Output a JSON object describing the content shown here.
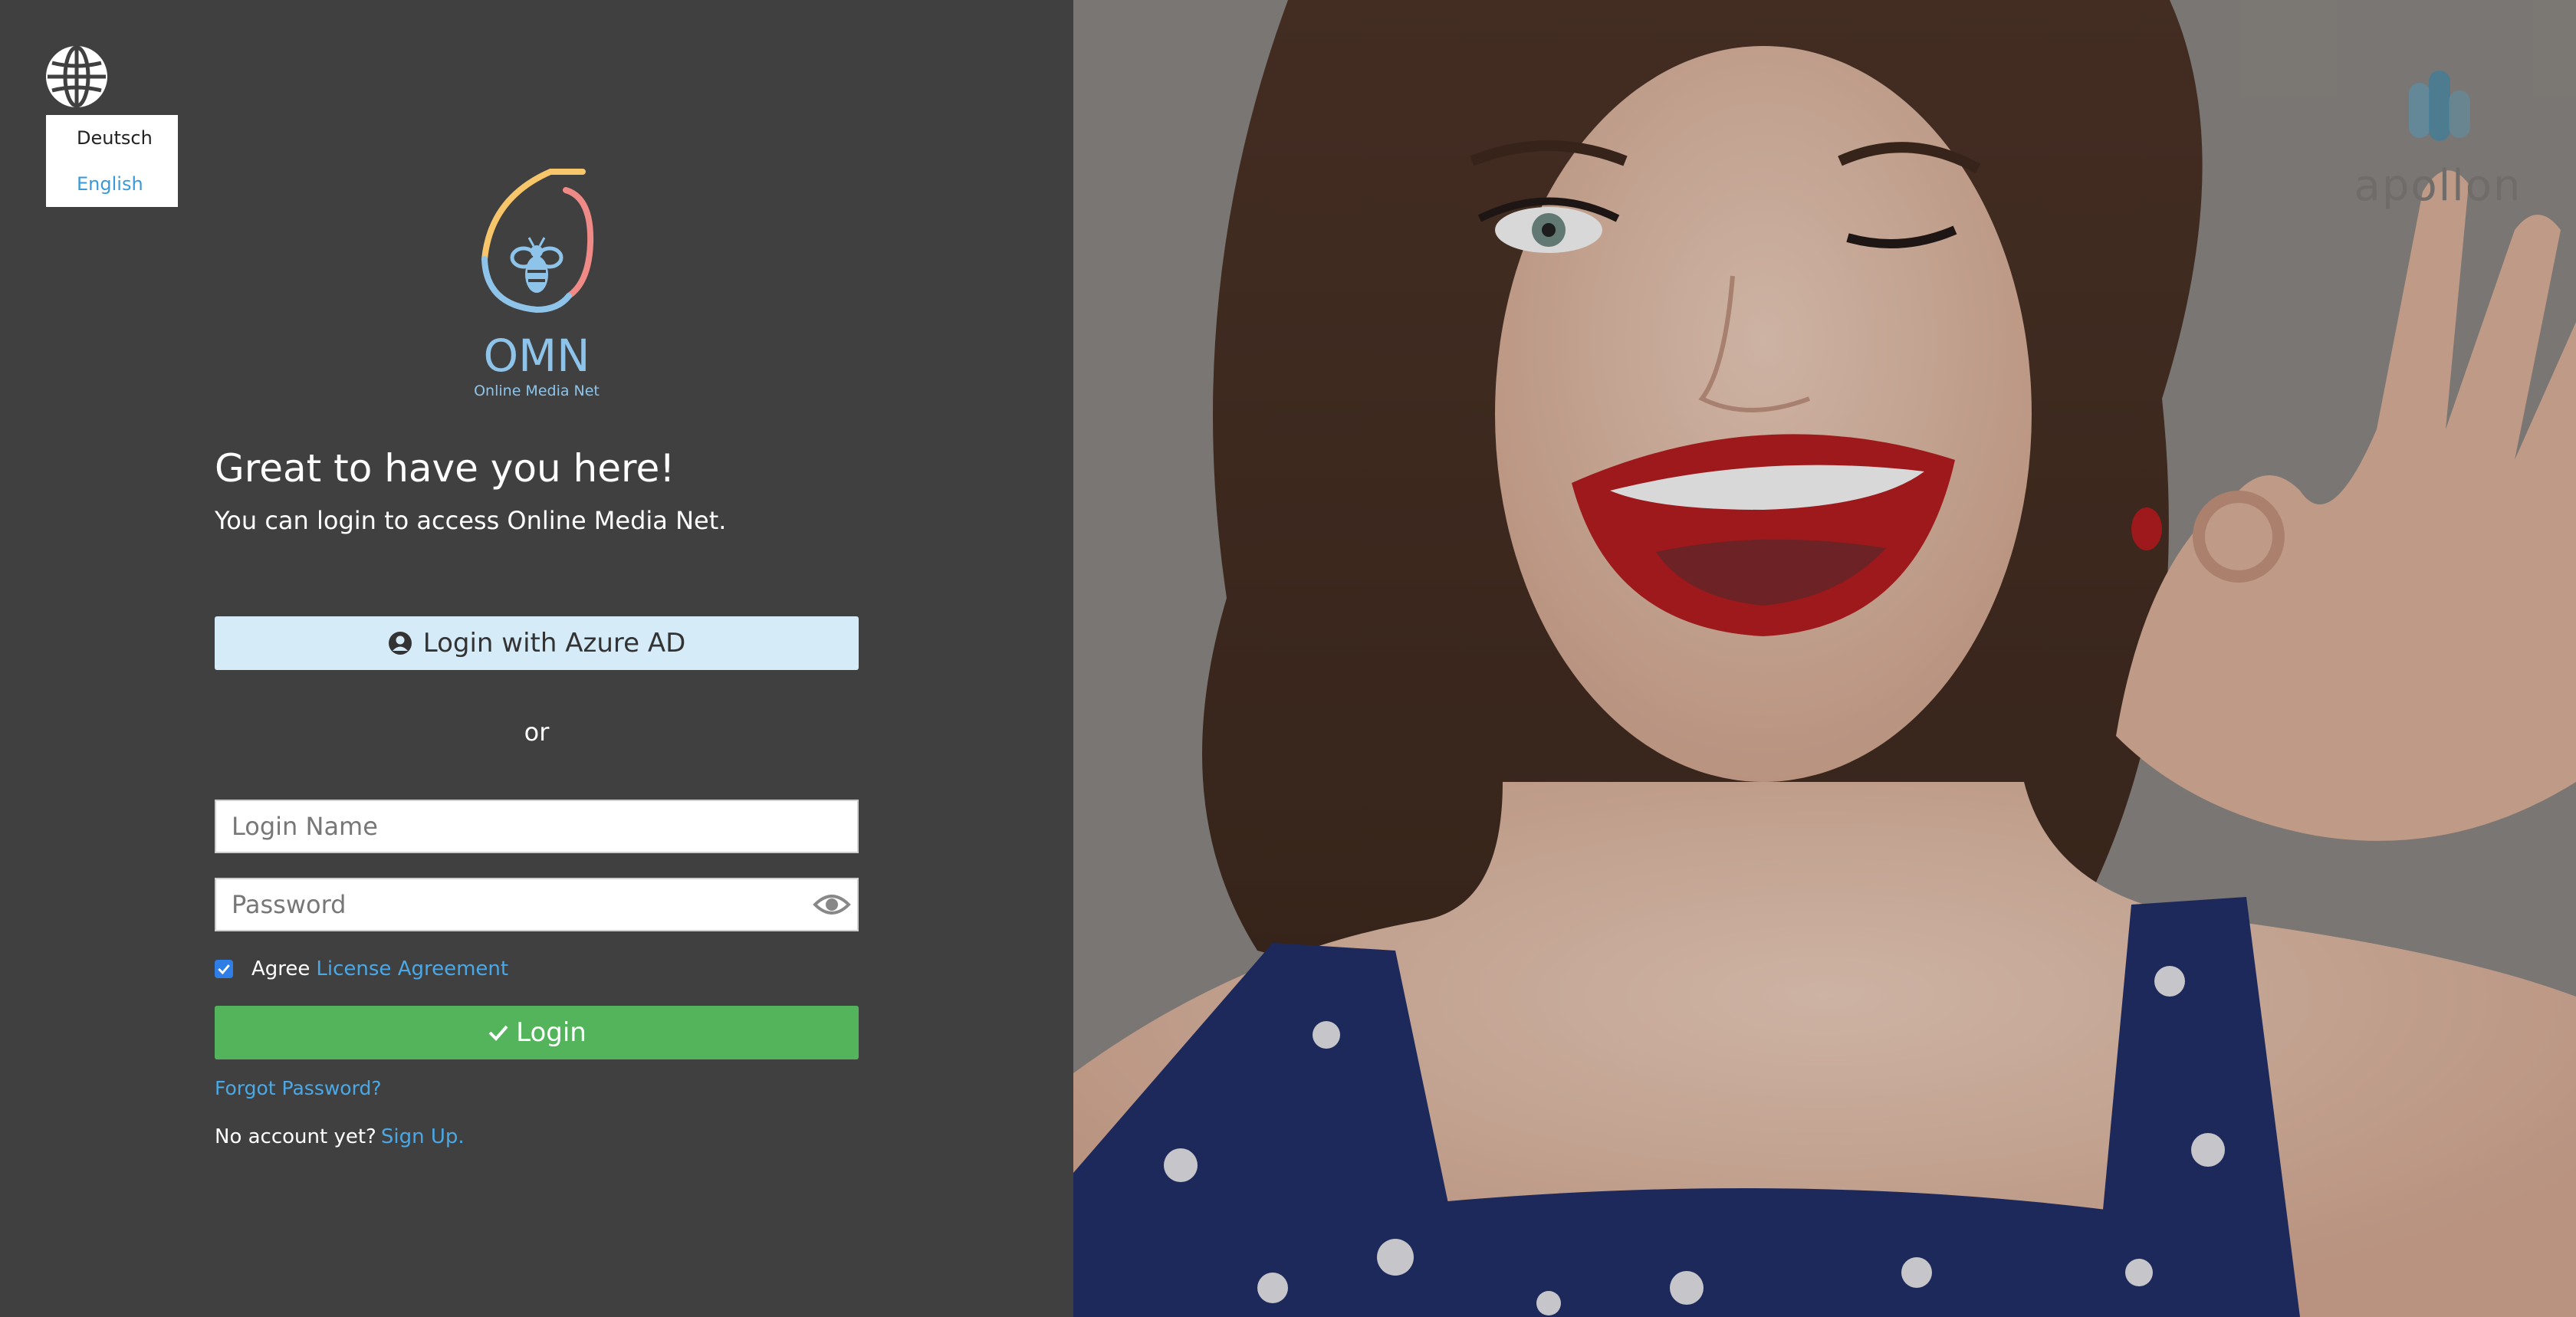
{
  "language_menu": {
    "items": [
      {
        "label": "Deutsch",
        "active": false
      },
      {
        "label": "English",
        "active": true
      }
    ]
  },
  "logo": {
    "name": "OMN",
    "tagline": "Online Media Net"
  },
  "welcome": {
    "title": "Great to have you here!",
    "subtitle": "You can login to access Online Media Net."
  },
  "azure_login": {
    "label": "Login with Azure AD",
    "icon": "user-circle-icon"
  },
  "separator": {
    "label": "or"
  },
  "form": {
    "login_name": {
      "placeholder": "Login Name",
      "value": ""
    },
    "password": {
      "placeholder": "Password",
      "value": ""
    },
    "agree": {
      "checked": true,
      "label": "Agree",
      "link_label": "License Agreement"
    },
    "submit_label": "Login",
    "forgot_label": "Forgot Password?",
    "signup_prompt": "No account yet?",
    "signup_link": "Sign Up."
  },
  "brand": {
    "name": "apollon"
  },
  "colors": {
    "panel_bg": "#404040",
    "azure_button_bg": "#d6ebf8",
    "login_button_bg": "#53b45c",
    "link": "#4aa8e6",
    "checkbox": "#2f7ee8"
  }
}
